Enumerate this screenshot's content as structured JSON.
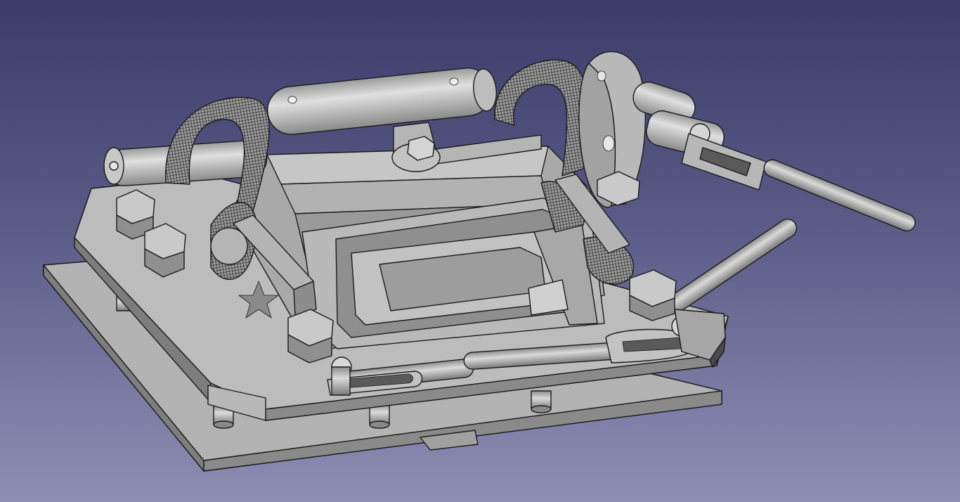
{
  "app": {
    "view": "3D viewport",
    "background_colors": {
      "top": "#3c3c6a",
      "mid": "#5b5b88",
      "bottom": "#8e8eb4"
    }
  },
  "model": {
    "kind": "mechanical assembly (shaded solid with edges)",
    "face_colors": {
      "light": "#c9c9c9",
      "mid": "#a7a7a7",
      "dark": "#7e7e7e",
      "edge": "#1a1a1a"
    },
    "parts": [
      "base-plate",
      "top-plate",
      "pivot-cylinder",
      "frame-body",
      "inner-frame",
      "coil-left",
      "coil-right",
      "disc-flange",
      "side-shaft",
      "clevis-rod",
      "lever-rod",
      "front-link",
      "hex-nuts",
      "mounting-posts",
      "bottom-tab"
    ]
  }
}
